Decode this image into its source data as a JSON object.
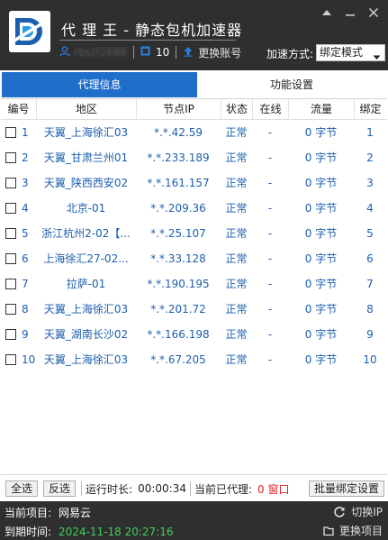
{
  "app": {
    "title": "代 理 王 - 静态包机加速器",
    "user_name": "rbszl2688",
    "count": "10",
    "switch_account": "更换账号",
    "mode_label": "加速方式:",
    "mode_value": "绑定模式"
  },
  "tabs": [
    {
      "label": "代理信息",
      "active": true
    },
    {
      "label": "功能设置",
      "active": false
    }
  ],
  "table": {
    "headers": [
      "编号",
      "地区",
      "节点IP",
      "状态",
      "在线",
      "流量",
      "绑定"
    ],
    "rows": [
      {
        "id": "1",
        "region": "天翼_上海徐汇03",
        "ip": "*.*.42.59",
        "status": "正常",
        "online": "-",
        "flow": "0 字节",
        "bind": "1"
      },
      {
        "id": "2",
        "region": "天翼_甘肃兰州01",
        "ip": "*.*.233.189",
        "status": "正常",
        "online": "-",
        "flow": "0 字节",
        "bind": "2"
      },
      {
        "id": "3",
        "region": "天翼_陕西西安02",
        "ip": "*.*.161.157",
        "status": "正常",
        "online": "-",
        "flow": "0 字节",
        "bind": "3"
      },
      {
        "id": "4",
        "region": "北京-01",
        "ip": "*.*.209.36",
        "status": "正常",
        "online": "-",
        "flow": "0 字节",
        "bind": "4"
      },
      {
        "id": "5",
        "region": "浙江杭州2-02【...",
        "ip": "*.*.25.107",
        "status": "正常",
        "online": "-",
        "flow": "0 字节",
        "bind": "5"
      },
      {
        "id": "6",
        "region": "上海徐汇27-02...",
        "ip": "*.*.33.128",
        "status": "正常",
        "online": "-",
        "flow": "0 字节",
        "bind": "6"
      },
      {
        "id": "7",
        "region": "拉萨-01",
        "ip": "*.*.190.195",
        "status": "正常",
        "online": "-",
        "flow": "0 字节",
        "bind": "7"
      },
      {
        "id": "8",
        "region": "天翼_上海徐汇03",
        "ip": "*.*.201.72",
        "status": "正常",
        "online": "-",
        "flow": "0 字节",
        "bind": "8"
      },
      {
        "id": "9",
        "region": "天翼_湖南长沙02",
        "ip": "*.*.166.198",
        "status": "正常",
        "online": "-",
        "flow": "0 字节",
        "bind": "9"
      },
      {
        "id": "10",
        "region": "天翼_上海徐汇03",
        "ip": "*.*.67.205",
        "status": "正常",
        "online": "-",
        "flow": "0 字节",
        "bind": "10"
      }
    ]
  },
  "footer": {
    "select_all": "全选",
    "invert": "反选",
    "runtime_label": "运行时长:",
    "runtime_value": "00:00:34",
    "proxied_label": "当前已代理:",
    "proxied_value": "0 窗口",
    "batch_bind": "批量绑定设置"
  },
  "bottom": {
    "project_label": "当前项目:",
    "project_value": "网易云",
    "expire_label": "到期时间:",
    "expire_value": "2024-11-18 20:27:16",
    "switch_ip": "切换IP",
    "change_project": "更换项目"
  },
  "colors": {
    "header_bg": "#2f2f2f",
    "accent": "#1f6ec9",
    "cell_text": "#1d5fad",
    "green": "#3fd05a",
    "red": "#e02020"
  }
}
